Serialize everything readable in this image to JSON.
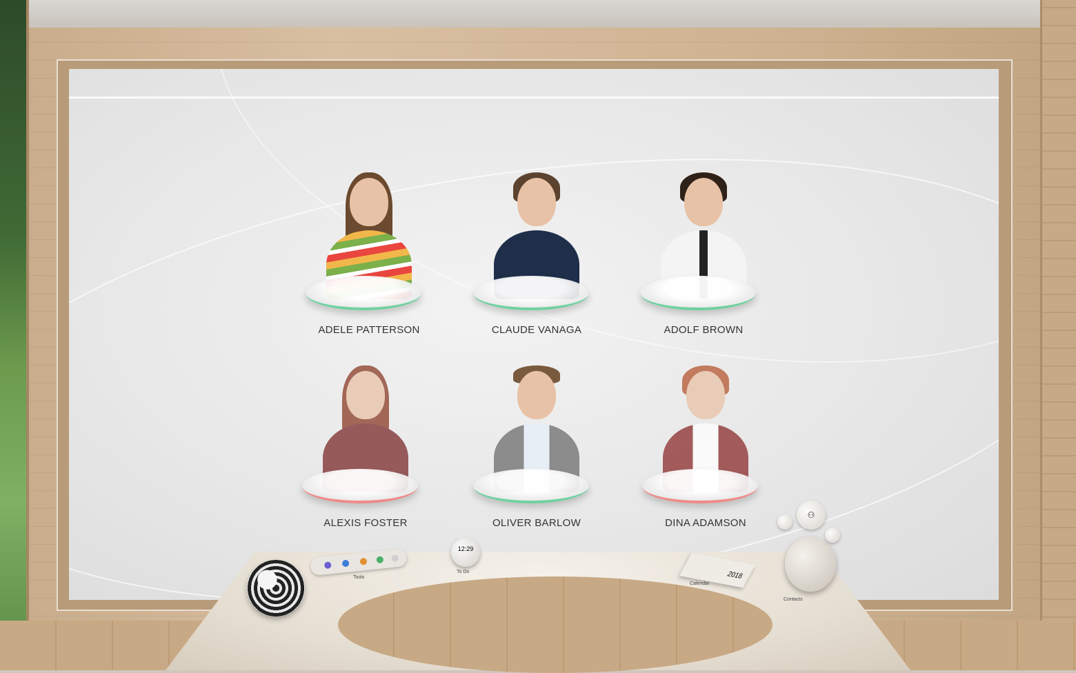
{
  "contacts": [
    {
      "name": "ADELE PATTERSON",
      "status": "online",
      "status_color": "#6fd19f"
    },
    {
      "name": "CLAUDE VANAGA",
      "status": "online",
      "status_color": "#6fd19f"
    },
    {
      "name": "ADOLF BROWN",
      "status": "online",
      "status_color": "#6fd19f"
    },
    {
      "name": "ALEXIS FOSTER",
      "status": "offline",
      "status_color": "#ef8a86"
    },
    {
      "name": "OLIVER BARLOW",
      "status": "online",
      "status_color": "#6fd19f"
    },
    {
      "name": "DINA ADAMSON",
      "status": "offline",
      "status_color": "#ef8a86"
    }
  ],
  "dock": {
    "clock_time": "12:29",
    "todo_label": "To Do",
    "tools_label": "Tools",
    "calendar_year": "2018",
    "calendar_label": "Calendar",
    "contacts_label": "Contacts"
  }
}
